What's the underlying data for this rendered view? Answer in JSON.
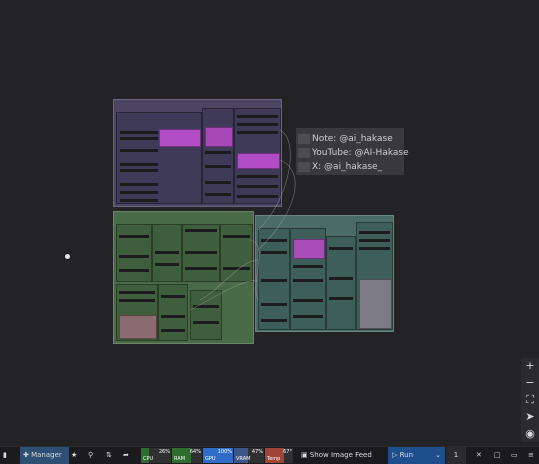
{
  "note": {
    "lines": [
      "Note: @ai_hakase",
      "YouTube: @AI-Hakase",
      "X: @ai_hakase_"
    ]
  },
  "zoom_controls": {
    "zoom_in": "+",
    "zoom_out": "−",
    "fit": "⛶",
    "locate": "➤",
    "toggle": "◉"
  },
  "bottom_bar": {
    "manager_label": "Manager",
    "cpu": {
      "label": "CPU",
      "percent": "26%",
      "level": 0.26
    },
    "ram": {
      "label": "RAM",
      "percent": "64%",
      "level": 0.64
    },
    "gpu": {
      "label": "GPU",
      "percent": "100%",
      "level": 1.0
    },
    "vram": {
      "label": "VRAM",
      "percent": "47%",
      "level": 0.47
    },
    "temp": {
      "label": "Temp",
      "percent": "67°",
      "level": 0.67
    },
    "show_image_feed": "Show Image Feed",
    "run_label": "Run",
    "queue_count": "1"
  },
  "colors": {
    "purple_group": "#4b4563",
    "green_group": "#4a6b47",
    "teal_group": "#4a6b66",
    "accent_magenta": "#b24cc4",
    "run_button": "#1e4f8c",
    "cpu": "#2e6d2e",
    "ram": "#2e6d2e",
    "gpu": "#2f6dc9",
    "vram": "#3d5588",
    "temp": "#a0443a"
  }
}
